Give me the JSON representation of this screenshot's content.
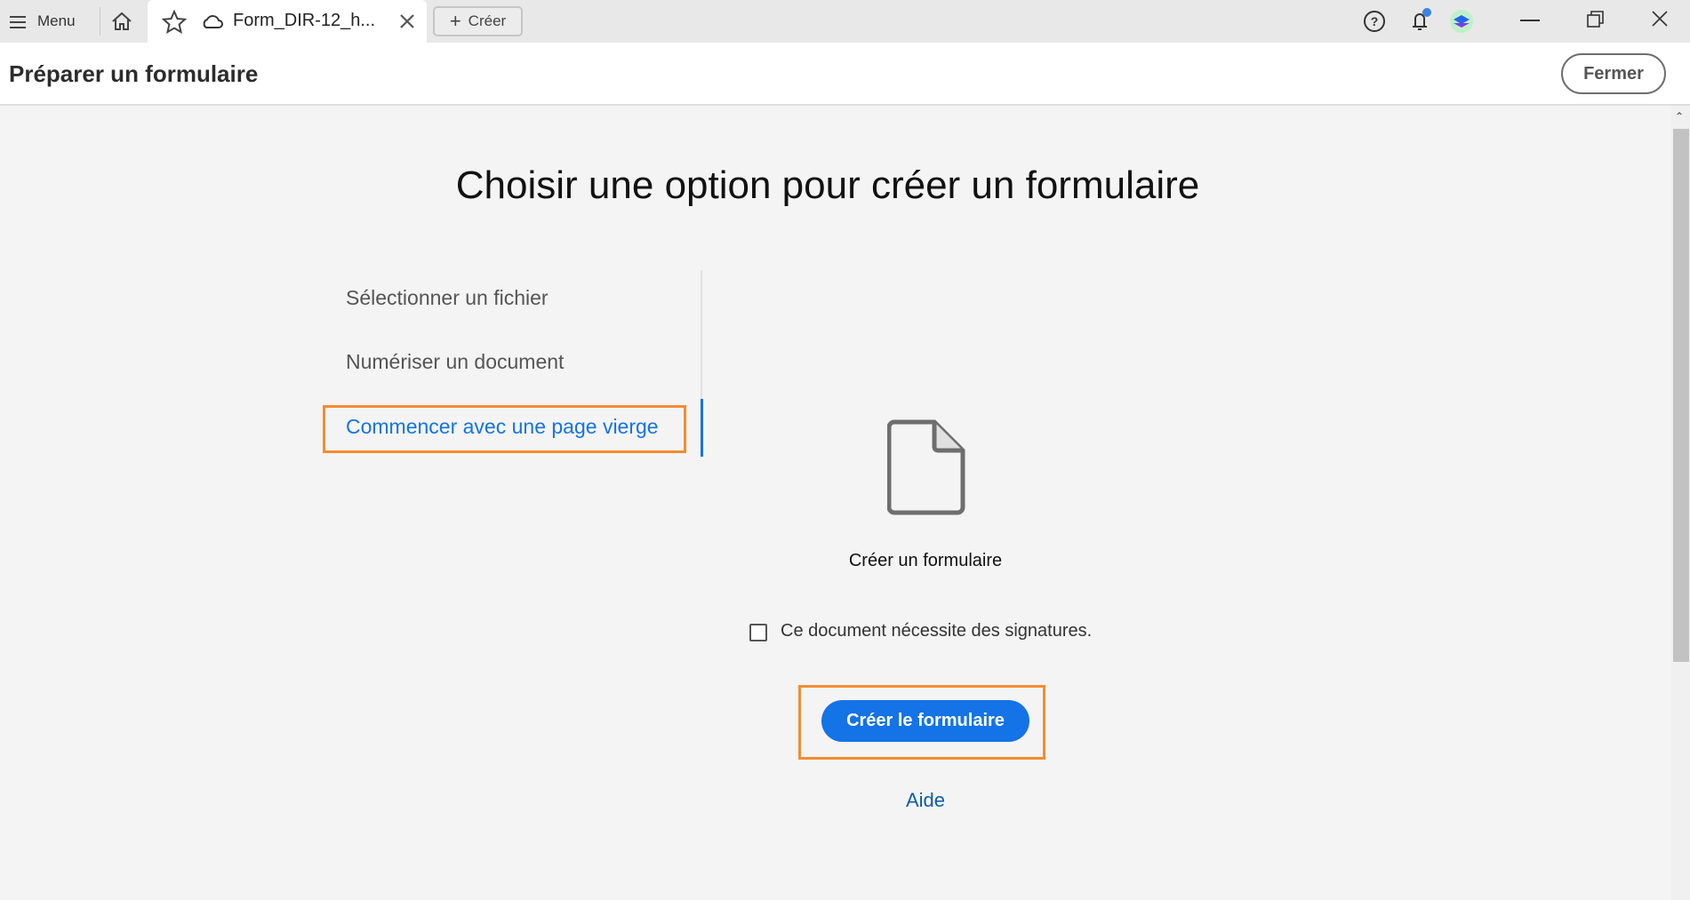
{
  "tabbar": {
    "menu_label": "Menu",
    "tab_title": "Form_DIR-12_h...",
    "create_label": "Créer"
  },
  "header": {
    "title": "Préparer un formulaire",
    "close_label": "Fermer"
  },
  "main": {
    "heading": "Choisir une option pour créer un formulaire",
    "options": [
      {
        "label": "Sélectionner un fichier"
      },
      {
        "label": "Numériser un document"
      },
      {
        "label": "Commencer avec une page vierge",
        "selected": true
      }
    ],
    "file_caption": "Créer un formulaire",
    "signature_checkbox": {
      "label": "Ce document nécessite des signatures.",
      "checked": false
    },
    "create_button": "Créer le formulaire",
    "help_link": "Aide"
  },
  "colors": {
    "accent": "#1473e6",
    "highlight": "#f58b32"
  }
}
